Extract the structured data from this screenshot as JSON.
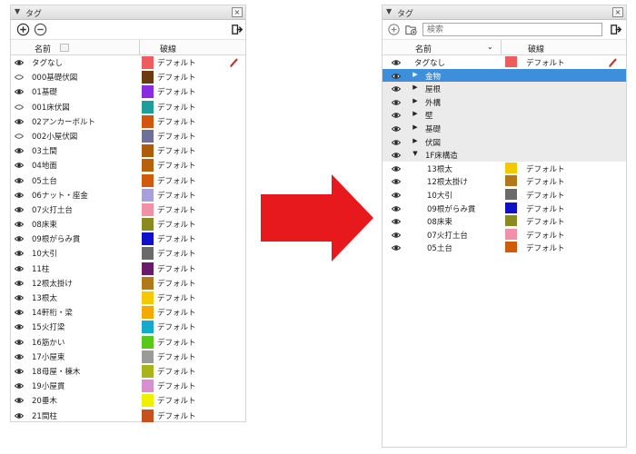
{
  "left_panel": {
    "title": "タグ",
    "toolbar": {
      "add_icon": "plus-circle-icon",
      "remove_icon": "minus-circle-icon",
      "details_icon": "export-arrow-icon"
    },
    "columns": {
      "name": "名前",
      "line": "破線"
    },
    "rows": [
      {
        "name": "タグなし",
        "color": "#ee5c5c",
        "line": "デフォルト",
        "visible": true
      },
      {
        "name": "000基礎伏図",
        "color": "#6b3a10",
        "line": "デフォルト",
        "visible": false
      },
      {
        "name": "01基礎",
        "color": "#8a2be2",
        "line": "デフォルト",
        "visible": true
      },
      {
        "name": "001床伏図",
        "color": "#1f9c9c",
        "line": "デフォルト",
        "visible": false
      },
      {
        "name": "02アンカーボルト",
        "color": "#d2550d",
        "line": "デフォルト",
        "visible": true
      },
      {
        "name": "002小屋伏図",
        "color": "#6e7099",
        "line": "デフォルト",
        "visible": false
      },
      {
        "name": "03土間",
        "color": "#b05a0c",
        "line": "デフォルト",
        "visible": true
      },
      {
        "name": "04地面",
        "color": "#b8600c",
        "line": "デフォルト",
        "visible": true
      },
      {
        "name": "05土台",
        "color": "#d05b0c",
        "line": "デフォルト",
        "visible": true
      },
      {
        "name": "06ナット・座金",
        "color": "#a8a0d8",
        "line": "デフォルト",
        "visible": true
      },
      {
        "name": "07火打土台",
        "color": "#f290a8",
        "line": "デフォルト",
        "visible": true
      },
      {
        "name": "08床束",
        "color": "#8a8a20",
        "line": "デフォルト",
        "visible": true
      },
      {
        "name": "09根がらみ貫",
        "color": "#1010c8",
        "line": "デフォルト",
        "visible": true
      },
      {
        "name": "10大引",
        "color": "#6a6a6a",
        "line": "デフォルト",
        "visible": true
      },
      {
        "name": "11柱",
        "color": "#6a1a6a",
        "line": "デフォルト",
        "visible": true
      },
      {
        "name": "12根太掛け",
        "color": "#b07818",
        "line": "デフォルト",
        "visible": true
      },
      {
        "name": "13根太",
        "color": "#f5c800",
        "line": "デフォルト",
        "visible": true
      },
      {
        "name": "14軒桁・梁",
        "color": "#f5a800",
        "line": "デフォルト",
        "visible": true
      },
      {
        "name": "15火打梁",
        "color": "#14aacc",
        "line": "デフォルト",
        "visible": true
      },
      {
        "name": "16筋かい",
        "color": "#5ac818",
        "line": "デフォルト",
        "visible": true
      },
      {
        "name": "17小屋束",
        "color": "#9a9a9a",
        "line": "デフォルト",
        "visible": true
      },
      {
        "name": "18母屋・棟木",
        "color": "#a8b418",
        "line": "デフォルト",
        "visible": true
      },
      {
        "name": "19小屋貫",
        "color": "#d88fd0",
        "line": "デフォルト",
        "visible": true
      },
      {
        "name": "20垂木",
        "color": "#f0f000",
        "line": "デフォルト",
        "visible": true
      },
      {
        "name": "21間柱",
        "color": "#c8501c",
        "line": "デフォルト",
        "visible": true
      }
    ]
  },
  "right_panel": {
    "title": "タグ",
    "toolbar": {
      "add_icon": "plus-circle-icon",
      "add_folder_icon": "add-folder-icon",
      "details_icon": "export-arrow-icon"
    },
    "search": {
      "placeholder": "検索"
    },
    "columns": {
      "name": "名前",
      "line": "破線"
    },
    "rows": [
      {
        "type": "tag",
        "name": "タグなし",
        "color": "#ee5c5c",
        "line": "デフォルト",
        "indent": 0
      },
      {
        "type": "folder",
        "name": "金物",
        "expanded": false,
        "selected": true,
        "indent": 0
      },
      {
        "type": "folder",
        "name": "屋根",
        "expanded": false,
        "indent": 0
      },
      {
        "type": "folder",
        "name": "外構",
        "expanded": false,
        "indent": 0
      },
      {
        "type": "folder",
        "name": "壁",
        "expanded": false,
        "indent": 0
      },
      {
        "type": "folder",
        "name": "基礎",
        "expanded": false,
        "indent": 0
      },
      {
        "type": "folder",
        "name": "伏図",
        "expanded": false,
        "indent": 0
      },
      {
        "type": "folder",
        "name": "1F床構造",
        "expanded": true,
        "indent": 0
      },
      {
        "type": "tag",
        "name": "13根太",
        "color": "#f5c800",
        "line": "デフォルト",
        "indent": 1
      },
      {
        "type": "tag",
        "name": "12根太掛け",
        "color": "#b07818",
        "line": "デフォルト",
        "indent": 1
      },
      {
        "type": "tag",
        "name": "10大引",
        "color": "#6a6a6a",
        "line": "デフォルト",
        "indent": 1
      },
      {
        "type": "tag",
        "name": "09根がらみ貫",
        "color": "#1010c8",
        "line": "デフォルト",
        "indent": 1
      },
      {
        "type": "tag",
        "name": "08床束",
        "color": "#8a8a20",
        "line": "デフォルト",
        "indent": 1
      },
      {
        "type": "tag",
        "name": "07火打土台",
        "color": "#f290a8",
        "line": "デフォルト",
        "indent": 1
      },
      {
        "type": "tag",
        "name": "05土台",
        "color": "#d05b0c",
        "line": "デフォルト",
        "indent": 1
      }
    ]
  },
  "arrow": {
    "color": "#e8191c"
  }
}
